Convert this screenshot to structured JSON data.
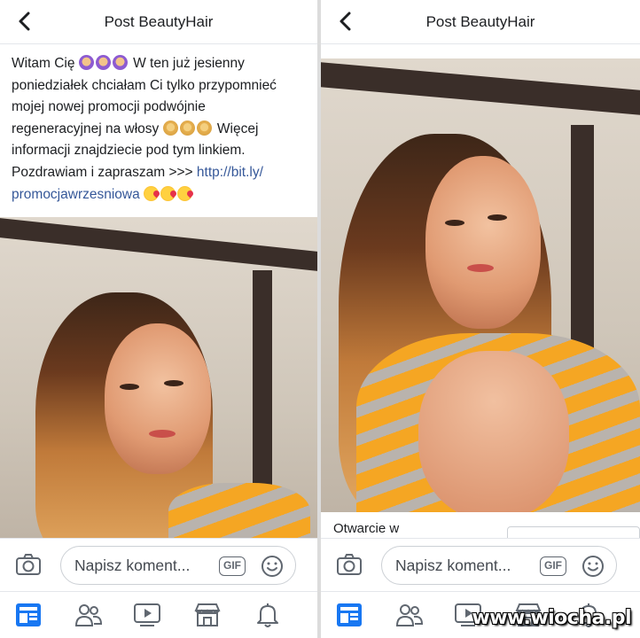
{
  "left_panel": {
    "header": {
      "title": "Post BeautyHair",
      "back_icon": "chevron-left-icon"
    },
    "post": {
      "line1_before": "Witam Cię",
      "line1_after": "W ten już jesienny",
      "line2": "poniedziałek chciałam Ci tylko przypomnieć",
      "line3": "mojej nowej promocji podwójnie",
      "line4_before": "regeneracyjnej na włosy",
      "line4_after": "Więcej",
      "line5": "informacji znajdziecie pod tym linkiem.",
      "line6_before": "Pozdrawiam i zapraszam >>> ",
      "link_part1": "http://bit.ly/",
      "link_part2": "promocjawrzesniowa",
      "emoji_1": "woman-emoji",
      "emoji_2": "gesture-emoji",
      "emoji_3": "kiss-emoji"
    },
    "composer": {
      "camera_icon": "camera-icon",
      "placeholder": "Napisz koment...",
      "gif_label": "GIF",
      "emoji_icon": "smiley-icon"
    },
    "tabbar": [
      "feed-icon",
      "friends-icon",
      "watch-icon",
      "marketplace-icon",
      "notifications-icon"
    ]
  },
  "right_panel": {
    "header": {
      "title": "Post BeautyHair",
      "back_icon": "chevron-left-icon"
    },
    "subtext": "Otwarcie w",
    "composer": {
      "camera_icon": "camera-icon",
      "placeholder": "Napisz koment...",
      "gif_label": "GIF",
      "emoji_icon": "smiley-icon"
    },
    "tabbar": [
      "feed-icon",
      "friends-icon",
      "watch-icon",
      "marketplace-icon",
      "notifications-icon"
    ]
  },
  "watermark": "www.wiocha.pl",
  "colors": {
    "link": "#365899",
    "tab_active": "#1877f2",
    "icon_gray": "#606770"
  }
}
